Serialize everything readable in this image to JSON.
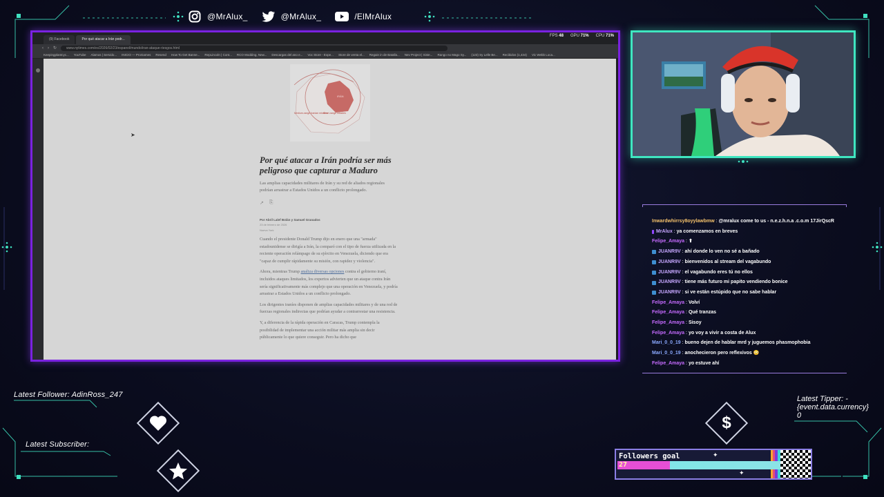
{
  "social": [
    {
      "icon": "instagram-icon",
      "handle": "@MrAlux_"
    },
    {
      "icon": "twitter-icon",
      "handle": "@MrAlux_"
    },
    {
      "icon": "youtube-icon",
      "handle": "/ElMrAlux"
    }
  ],
  "browser": {
    "tabs": [
      "(9) Facebook",
      "Por qué atacar a Irán podr..."
    ],
    "url": "www.nytimes.com/es/2026/02/23/espanol/mundo/iran-ataque-riesgos.html",
    "perf": {
      "fps_label": "FPS",
      "fps": "48",
      "gpu_label": "GPU",
      "gpu": "71%",
      "cpu_label": "CPU",
      "cpu": "71%"
    },
    "bookmarks": [
      "Keepingplantcyc...",
      "YouTube",
      "Alamos | Servido...",
      "INICIO — ProGames",
      "Resend",
      "How To Get Banne...",
      "RepLincoln | Cont...",
      "RCO Modding, New...",
      "Descargas del ano e...",
      "Voc Store - Expe...",
      "Store de venta el...",
      "Regain in de Batalla...",
      "Nev Project | Siste...",
      "Rango no Mago Sy...",
      "(123) Sy Lelle Be...",
      "Recibidos (1,434)",
      "Vic Webb Loca..."
    ]
  },
  "article": {
    "headline": "Por qué atacar a Irán podría ser más peligroso que capturar a Maduro",
    "summary": "Las amplias capacidades militares de Irán y su red de aliados regionales podrían arrastrar a Estados Unidos a un conflicto prolongado.",
    "byline": "Por Abril Lalef Bolán y Samuel Granados",
    "date": "23 de febrero de 2026",
    "updated": "Nueva York",
    "map_labels": {
      "country": "IRÁN",
      "medium": "Medium-range Iranian missiles",
      "short": "Short-range missiles"
    },
    "p1": "Cuando el presidente Donald Trump dijo en enero que una \"armada\" estadounidense se dirigía a Irán, la comparó con el tipo de fuerza utilizada en la reciente operación relámpago de su ejército en Venezuela, diciendo que era \"capaz de cumplir rápidamente su misión, con rapidez y violencia\".",
    "p2_a": "Ahora, mientras Trump ",
    "p2_link": "analiza diversas opciones",
    "p2_b": " contra el gobierno iraní, incluidos ataques limitados, los expertos advierten que un ataque contra Irán sería significativamente más complejo que una operación en Venezuela, y podría arrastrar a Estados Unidos a un conflicto prolongado.",
    "p3": "Los dirigentes iraníes disponen de amplias capacidades militares y de una red de fuerzas regionales indirectas que podrían ayudar a contrarrestar una resistencia.",
    "p4": "Y, a diferencia de la rápida operación en Caracas, Trump contempla la posibilidad de implementar una acción militar más amplia sin decir públicamente lo que quiere conseguir. Pero ha dicho que"
  },
  "chat": [
    {
      "badge": "none",
      "user": "Inwardwhirrsy8oyylawbmw",
      "color": "#f5c26b",
      "text": "@mralux come to us - n.e.z.h.n.a .c.o.m 17JirQscR"
    },
    {
      "badge": "sub",
      "user": "MrAlux",
      "color": "#c6a7ff",
      "text": "ya comenzamos en breves"
    },
    {
      "badge": "none",
      "user": "Felipe_Amaya",
      "color": "#c66bff",
      "text": "⬆"
    },
    {
      "badge": "blue",
      "user": "JUANR9V",
      "color": "#c6a7ff",
      "text": "ahí donde lo ven no sé a bañado"
    },
    {
      "badge": "blue",
      "user": "JUANR9V",
      "color": "#c6a7ff",
      "text": "bienvenidos al stream del vagabundo"
    },
    {
      "badge": "blue",
      "user": "JUANR9V",
      "color": "#c6a7ff",
      "text": "el vagabundo eres tú no ellos"
    },
    {
      "badge": "blue",
      "user": "JUANR9V",
      "color": "#c6a7ff",
      "text": "tiene más futuro mi papito vendiendo bonice"
    },
    {
      "badge": "blue",
      "user": "JUANR9V",
      "color": "#c6a7ff",
      "text": "si ve están estúpido que no sabe hablar"
    },
    {
      "badge": "none",
      "user": "Felipe_Amaya",
      "color": "#c66bff",
      "text": "Volví"
    },
    {
      "badge": "none",
      "user": "Felipe_Amaya",
      "color": "#c66bff",
      "text": "Qué tranzas"
    },
    {
      "badge": "none",
      "user": "Felipe_Amaya",
      "color": "#c66bff",
      "text": "Sisoy"
    },
    {
      "badge": "none",
      "user": "Felipe_Amaya",
      "color": "#c66bff",
      "text": "yo voy a vivir a costa de Alux"
    },
    {
      "badge": "none",
      "user": "Mari_0_0_19",
      "color": "#8aa9ff",
      "text": "bueno dejen de hablar mrd y juguemos phasmophobia"
    },
    {
      "badge": "none",
      "user": "Mari_0_0_19",
      "color": "#8aa9ff",
      "text": "anochecieron pero reflexivos 😳"
    },
    {
      "badge": "none",
      "user": "Felipe_Amaya",
      "color": "#c66bff",
      "text": "yo estuve ahí"
    }
  ],
  "latest": {
    "follower": "Latest Follower: AdinRoss_247",
    "subscriber": "Latest Subscriber:",
    "tipper_line1": "Latest Tipper: -",
    "tipper_line2": "{event.data.currency}",
    "tipper_line3": "0"
  },
  "goal": {
    "title": "Followers goal",
    "current": "27",
    "target": "100",
    "progress_fraction": 0.27
  },
  "colors": {
    "frame": "#7a22e0",
    "webcam_border": "#3fe6c0",
    "accent": "#3de0b8"
  }
}
